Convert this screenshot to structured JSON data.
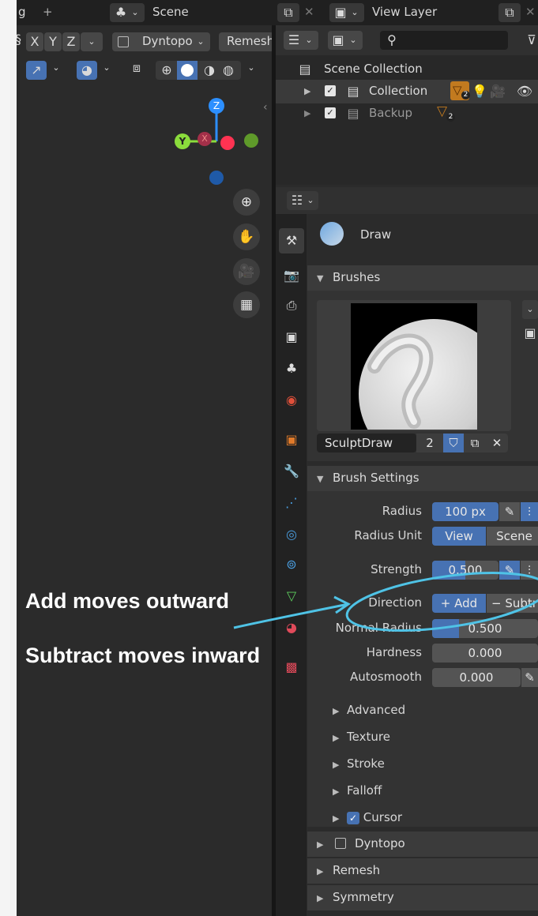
{
  "topbar": {
    "left_tab_fragment": "g",
    "add_tab": "+",
    "scene_label": "Scene",
    "view_layer_label": "View Layer"
  },
  "viewport_header": {
    "axis_x": "X",
    "axis_y": "Y",
    "axis_z": "Z",
    "dyntopo": "Dyntopo",
    "remesh": "Remesh"
  },
  "gizmo": {
    "z": "Z",
    "y": "Y",
    "x": "X"
  },
  "outliner": {
    "scene_collection": "Scene Collection",
    "rows": [
      {
        "name": "Collection",
        "badge": "2"
      },
      {
        "name": "Backup",
        "badge": "2"
      }
    ]
  },
  "properties": {
    "tool_name": "Draw",
    "brushes_panel": "Brushes",
    "brush_name": "SculptDraw",
    "brush_users": "2",
    "brush_settings_panel": "Brush Settings",
    "fields": {
      "radius_label": "Radius",
      "radius_value": "100 px",
      "radius_unit_label": "Radius Unit",
      "radius_unit_view": "View",
      "radius_unit_scene": "Scene",
      "strength_label": "Strength",
      "strength_value": "0.500",
      "strength_fraction": 0.5,
      "direction_label": "Direction",
      "direction_add": "+ Add",
      "direction_subtract": "− Subtr",
      "normal_radius_label": "Normal Radius",
      "normal_radius_value": "0.500",
      "hardness_label": "Hardness",
      "hardness_value": "0.000",
      "autosmooth_label": "Autosmooth",
      "autosmooth_value": "0.000"
    },
    "subpanels": [
      "Advanced",
      "Texture",
      "Stroke",
      "Falloff",
      "Cursor"
    ],
    "panels": [
      "Dyntopo",
      "Remesh",
      "Symmetry"
    ]
  },
  "annotations": {
    "add": "Add moves outward",
    "subtract": "Subtract moves inward"
  },
  "colors": {
    "accent": "#4772b3",
    "annotation_stroke": "#4fc3e6",
    "gizmo_z": "#2c8fff",
    "gizmo_y": "#8bdc3c",
    "gizmo_x": "#ff3352"
  }
}
